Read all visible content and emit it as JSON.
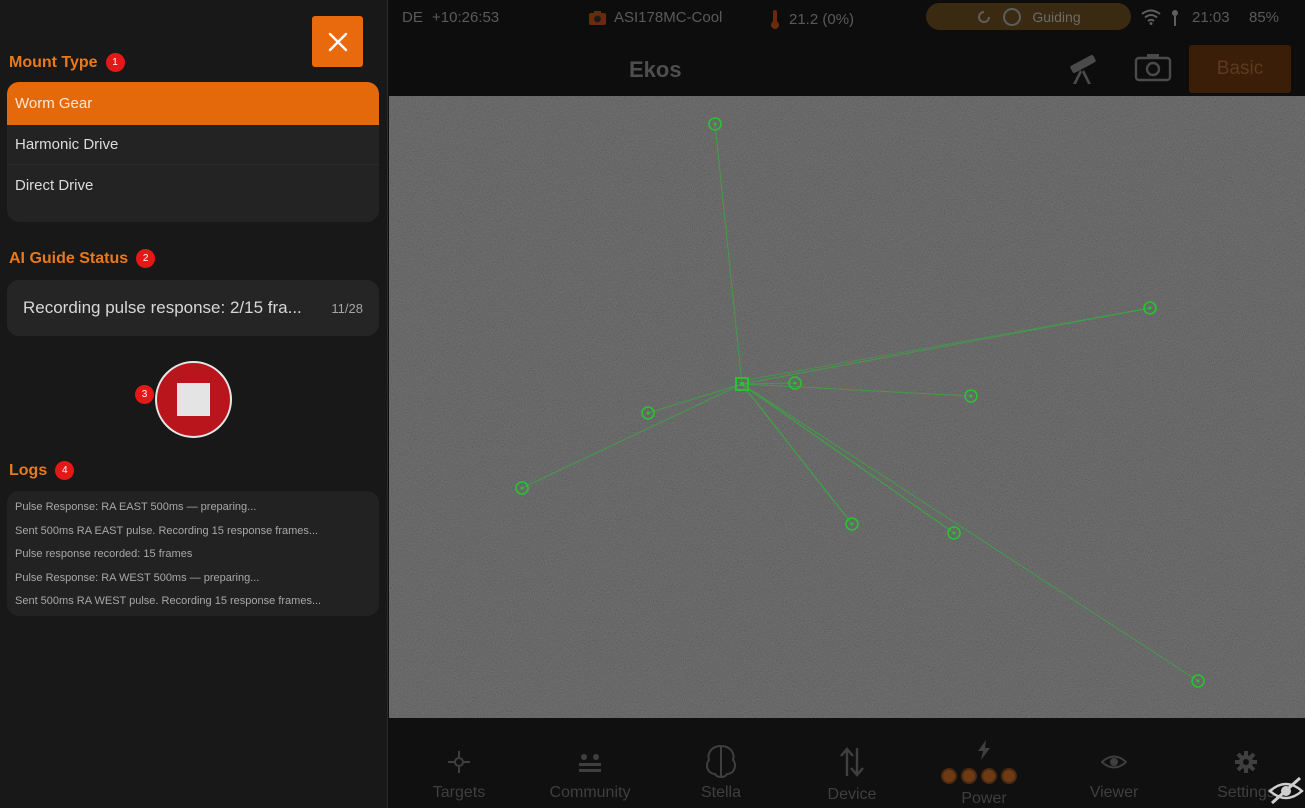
{
  "colors": {
    "accent": "#e8791c",
    "active_bg": "#e4690b",
    "badge": "#e51818",
    "stop": "#b8161c",
    "overlay": "#27c430"
  },
  "mount_type": {
    "title": "Mount Type",
    "badge": "1",
    "options": [
      "Worm Gear",
      "Harmonic Drive",
      "Direct Drive"
    ],
    "selected": "Worm Gear"
  },
  "ai_guide": {
    "title": "AI Guide Status",
    "badge": "2",
    "status": "Recording pulse response: 2/15 fra...",
    "count": "11/28"
  },
  "stop_badge": "3",
  "logs": {
    "title": "Logs",
    "badge": "4",
    "lines": [
      "Pulse Response: RA EAST 500ms — preparing...",
      "Sent 500ms RA EAST pulse. Recording 15 response frames...",
      "Pulse response recorded: 15 frames",
      "Pulse Response: RA WEST 500ms — preparing...",
      "Sent 500ms RA WEST pulse. Recording 15 response frames..."
    ]
  },
  "statusbar": {
    "mode": "DE",
    "offset": "+10:26:53",
    "camera": "ASI178MC-Cool",
    "temperature": "21.2 (0%)",
    "guiding": "Guiding",
    "clock": "21:03",
    "battery": "85%"
  },
  "header": {
    "title": "Ekos",
    "basic_label": "Basic"
  },
  "nav": {
    "items": [
      "Targets",
      "Community",
      "Stella",
      "Device",
      "Power",
      "Viewer",
      "Settings"
    ]
  }
}
